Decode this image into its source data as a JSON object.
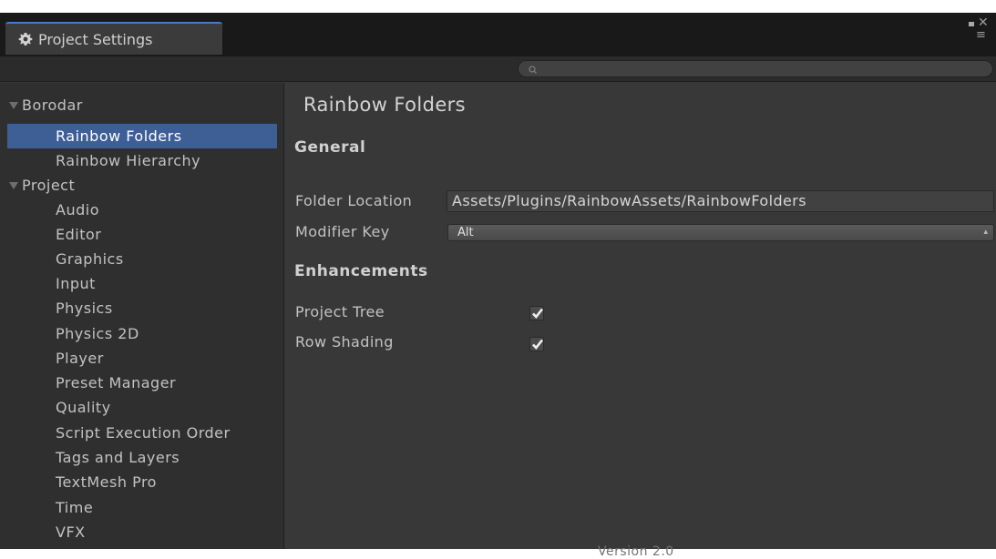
{
  "window": {
    "tab_title": "Project Settings"
  },
  "search": {
    "placeholder": ""
  },
  "sidebar": {
    "items": [
      {
        "label": "Borodar",
        "kind": "group"
      },
      {
        "label": "Rainbow Folders",
        "kind": "child",
        "selected": true
      },
      {
        "label": "Rainbow Hierarchy",
        "kind": "child"
      },
      {
        "label": "Project",
        "kind": "group"
      },
      {
        "label": "Audio",
        "kind": "child"
      },
      {
        "label": "Editor",
        "kind": "child"
      },
      {
        "label": "Graphics",
        "kind": "child"
      },
      {
        "label": "Input",
        "kind": "child"
      },
      {
        "label": "Physics",
        "kind": "child"
      },
      {
        "label": "Physics 2D",
        "kind": "child"
      },
      {
        "label": "Player",
        "kind": "child"
      },
      {
        "label": "Preset Manager",
        "kind": "child"
      },
      {
        "label": "Quality",
        "kind": "child"
      },
      {
        "label": "Script Execution Order",
        "kind": "child"
      },
      {
        "label": "Tags and Layers",
        "kind": "child"
      },
      {
        "label": "TextMesh Pro",
        "kind": "child"
      },
      {
        "label": "Time",
        "kind": "child"
      },
      {
        "label": "VFX",
        "kind": "child"
      }
    ]
  },
  "main": {
    "title": "Rainbow Folders",
    "general": {
      "heading": "General",
      "folder_location_label": "Folder Location",
      "folder_location_value": "Assets/Plugins/RainbowAssets/RainbowFolders",
      "modifier_key_label": "Modifier Key",
      "modifier_key_value": "Alt"
    },
    "enhancements": {
      "heading": "Enhancements",
      "project_tree_label": "Project Tree",
      "project_tree_checked": true,
      "row_shading_label": "Row Shading",
      "row_shading_checked": true
    },
    "version": "Version 2.0"
  },
  "icons": {
    "tab": "gear-icon",
    "search": "search-icon",
    "expand": "triangle-down-icon",
    "check": "checkmark-icon"
  },
  "colors": {
    "selection": "#3e5f96",
    "tab_accent": "#4a79c7",
    "background": "#383838"
  }
}
